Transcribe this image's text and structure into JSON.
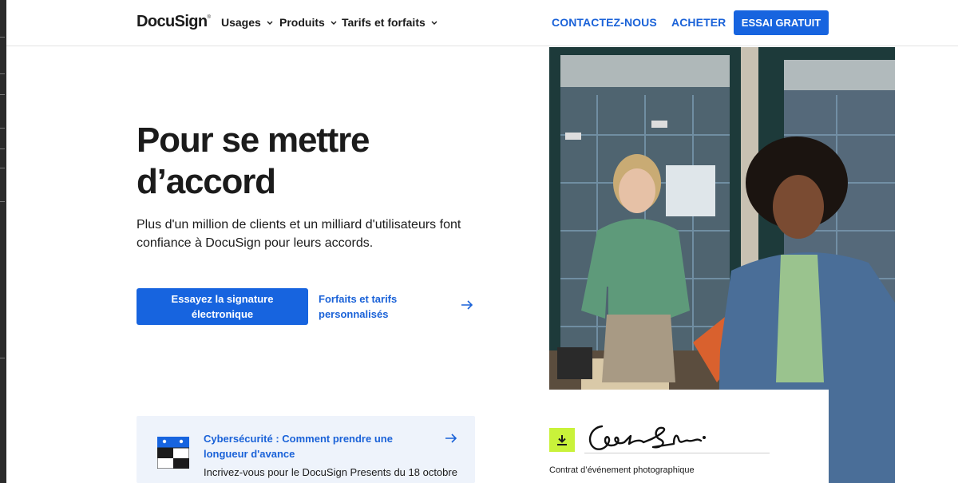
{
  "header": {
    "logo": "DocuSign",
    "nav": [
      {
        "label": "Usages"
      },
      {
        "label": "Produits"
      },
      {
        "label": "Tarifs et forfaits"
      }
    ],
    "contact": "CONTACTEZ-NOUS",
    "buy": "ACHETER",
    "trial": "ESSAI GRATUIT"
  },
  "hero": {
    "title": "Pour se mettre d’accord",
    "subtitle": "Plus d'un million de clients et un milliard d'utilisateurs font confiance à DocuSign pour leurs accords.",
    "primary_cta": "Essayez la signature électronique",
    "secondary_cta": "Forfaits et tarifs personnalisés"
  },
  "promo": {
    "title": "Cybersécurité : Comment prendre une longueur d'avance",
    "description": "Incrivez-vous pour le DocuSign Presents du 18 octobre"
  },
  "signature_card": {
    "caption": "Contrat d’événement photographique"
  },
  "colors": {
    "accent": "#1764df",
    "link": "#1a62d8",
    "download_badge": "#c9f23a",
    "promo_bg": "#eef3fb"
  },
  "icons": [
    "chevron-down-icon",
    "arrow-right-icon",
    "event-calendar-icon",
    "download-icon"
  ]
}
